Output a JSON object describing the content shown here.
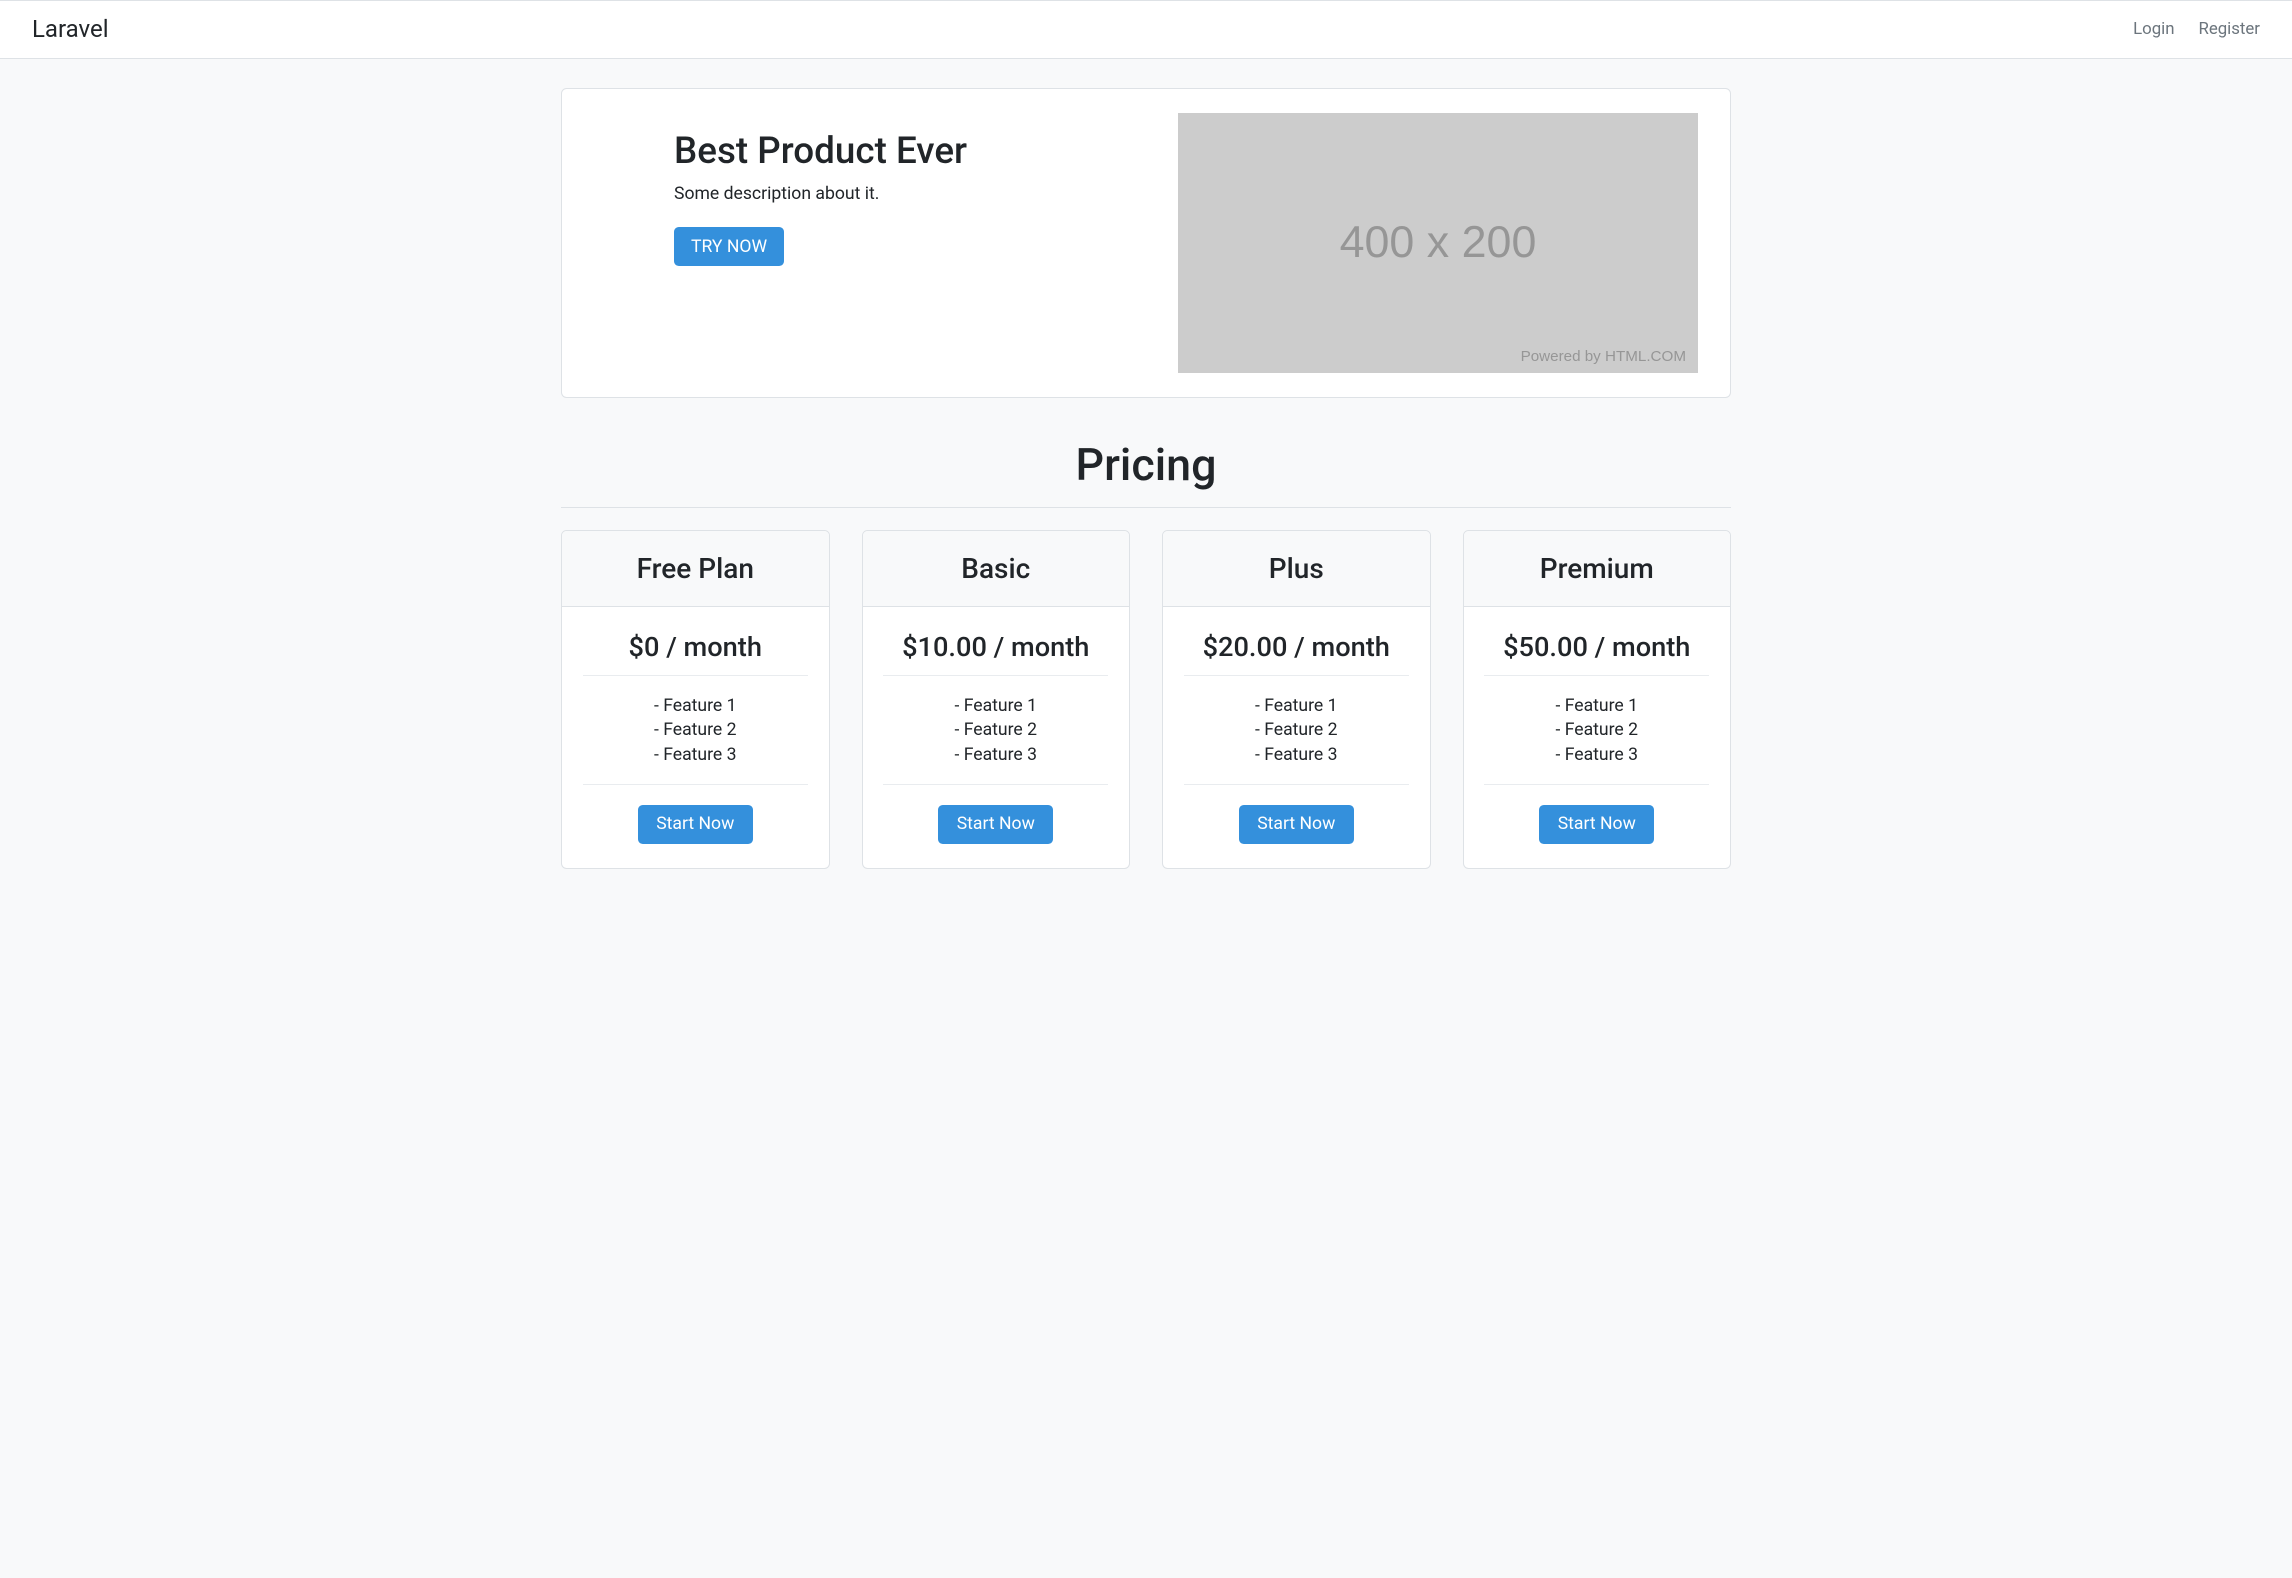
{
  "navbar": {
    "brand": "Laravel",
    "login": "Login",
    "register": "Register"
  },
  "hero": {
    "title": "Best Product Ever",
    "description": "Some description about it.",
    "cta": "TRY NOW",
    "placeholder_text": "400 x 200",
    "placeholder_credit": "Powered by HTML.COM"
  },
  "pricing": {
    "title": "Pricing",
    "start_label": "Start Now",
    "plans": [
      {
        "name": "Free Plan",
        "price": "$0 / month",
        "features": [
          "- Feature 1",
          "- Feature 2",
          "- Feature 3"
        ]
      },
      {
        "name": "Basic",
        "price": "$10.00 / month",
        "features": [
          "- Feature 1",
          "- Feature 2",
          "- Feature 3"
        ]
      },
      {
        "name": "Plus",
        "price": "$20.00 / month",
        "features": [
          "- Feature 1",
          "- Feature 2",
          "- Feature 3"
        ]
      },
      {
        "name": "Premium",
        "price": "$50.00 / month",
        "features": [
          "- Feature 1",
          "- Feature 2",
          "- Feature 3"
        ]
      }
    ]
  }
}
